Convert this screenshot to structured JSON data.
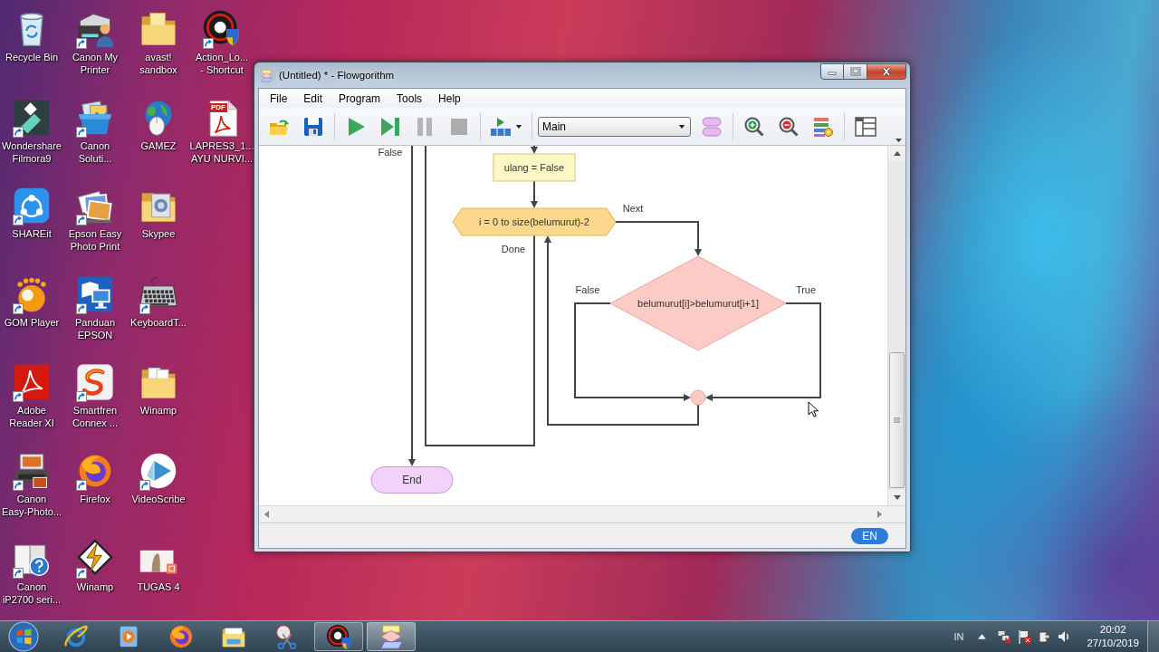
{
  "desktop_icons": [
    {
      "label": "Recycle Bin",
      "shortcut": false
    },
    {
      "label": "Wondershare\nFilmora9",
      "shortcut": true
    },
    {
      "label": "SHAREit",
      "shortcut": true
    },
    {
      "label": "GOM Player",
      "shortcut": true
    },
    {
      "label": "Adobe\nReader XI",
      "shortcut": true
    },
    {
      "label": "Canon\nEasy-Photo...",
      "shortcut": true
    },
    {
      "label": "Canon\niP2700 seri...",
      "shortcut": true
    },
    {
      "label": "Canon My\nPrinter",
      "shortcut": true
    },
    {
      "label": "Canon\nSoluti...",
      "shortcut": true
    },
    {
      "label": "Epson Easy\nPhoto Print",
      "shortcut": true
    },
    {
      "label": "Panduan\nEPSON",
      "shortcut": true
    },
    {
      "label": "Smartfren\nConnex ...",
      "shortcut": true
    },
    {
      "label": "Firefox",
      "shortcut": true
    },
    {
      "label": "Winamp",
      "shortcut": true
    },
    {
      "label": "avast!\nsandbox",
      "shortcut": false
    },
    {
      "label": "GAMEZ",
      "shortcut": false
    },
    {
      "label": "Skypee",
      "shortcut": false
    },
    {
      "label": "KeyboardT...",
      "shortcut": true
    },
    {
      "label": "Winamp",
      "shortcut": false
    },
    {
      "label": "VideoScribe",
      "shortcut": true
    },
    {
      "label": "TUGAS 4",
      "shortcut": false
    },
    {
      "label": "Action_Lo...\n- Shortcut",
      "shortcut": true
    },
    {
      "label": "LAPRES3_1...\nAYU NURVI...",
      "shortcut": false,
      "badge": "PDF"
    }
  ],
  "window": {
    "title": "(Untitled) * - Flowgorithm",
    "menu": [
      "File",
      "Edit",
      "Program",
      "Tools",
      "Help"
    ],
    "toolbar": [
      {
        "kind": "button",
        "disabled": false
      },
      {
        "kind": "button",
        "disabled": false
      },
      {
        "kind": "separator"
      },
      {
        "kind": "button",
        "disabled": false
      },
      {
        "kind": "button",
        "disabled": false
      },
      {
        "kind": "button",
        "disabled": true
      },
      {
        "kind": "button",
        "disabled": true
      },
      {
        "kind": "separator"
      },
      {
        "kind": "menu_button",
        "disabled": false
      },
      {
        "kind": "separator"
      },
      {
        "kind": "select",
        "value": "Main"
      },
      {
        "kind": "button",
        "disabled": false
      },
      {
        "kind": "separator"
      },
      {
        "kind": "button",
        "disabled": false
      },
      {
        "kind": "button",
        "disabled": false
      },
      {
        "kind": "button",
        "disabled": false
      },
      {
        "kind": "separator"
      },
      {
        "kind": "button",
        "disabled": false
      }
    ],
    "flowchart": {
      "nodes": [
        {
          "kind": "terminal",
          "text": "End"
        },
        {
          "kind": "process",
          "text": "ulang = False"
        },
        {
          "kind": "loop",
          "text": "i = 0 to size(belumurut)-2"
        },
        {
          "kind": "decision",
          "text": "belumurut[i]>belumurut[i+1]"
        },
        {
          "kind": "junction"
        }
      ],
      "branch_labels": [
        "False",
        "Next",
        "Done",
        "False",
        "True"
      ]
    },
    "status_bar": {
      "language": "EN"
    }
  },
  "taskbar": {
    "items": [
      {
        "running": false,
        "selected": false
      },
      {
        "running": false,
        "selected": false
      },
      {
        "running": false,
        "selected": false
      },
      {
        "running": false,
        "selected": false
      },
      {
        "running": false,
        "selected": false
      },
      {
        "running": true,
        "selected": false
      },
      {
        "running": true,
        "selected": true
      }
    ],
    "tray": {
      "input_language": "IN"
    },
    "clock": {
      "time": "20:02",
      "date": "27/10/2019"
    }
  }
}
